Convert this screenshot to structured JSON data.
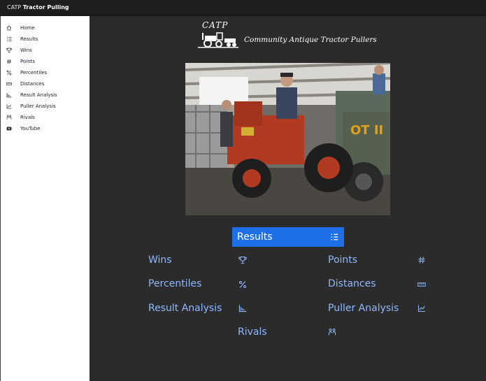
{
  "header": {
    "brand_prefix": "CATP",
    "brand_title": "Tractor Pulling"
  },
  "sidebar": {
    "items": [
      {
        "label": "Home",
        "icon": "home-icon"
      },
      {
        "label": "Results",
        "icon": "ordered-list-icon"
      },
      {
        "label": "Wins",
        "icon": "trophy-icon"
      },
      {
        "label": "Points",
        "icon": "hash-icon"
      },
      {
        "label": "Percentiles",
        "icon": "percent-icon"
      },
      {
        "label": "Distances",
        "icon": "ruler-icon"
      },
      {
        "label": "Result Analysis",
        "icon": "bar-chart-icon"
      },
      {
        "label": "Puller Analysis",
        "icon": "line-chart-icon"
      },
      {
        "label": "Rivals",
        "icon": "rivals-icon"
      },
      {
        "label": "YouTube",
        "icon": "youtube-icon"
      }
    ]
  },
  "main": {
    "logo_short": "CATP",
    "logo_name": "Community Antique Tractor Pullers",
    "results_label": "Results",
    "links": {
      "wins": "Wins",
      "points": "Points",
      "percentiles": "Percentiles",
      "distances": "Distances",
      "result_analysis": "Result Analysis",
      "puller_analysis": "Puller Analysis",
      "rivals": "Rivals"
    }
  },
  "colors": {
    "accent": "#1f6fe8",
    "link": "#8fb8ff",
    "background": "#2b2b2b",
    "topbar": "#1e1e1e",
    "sidebar": "#ffffff"
  }
}
